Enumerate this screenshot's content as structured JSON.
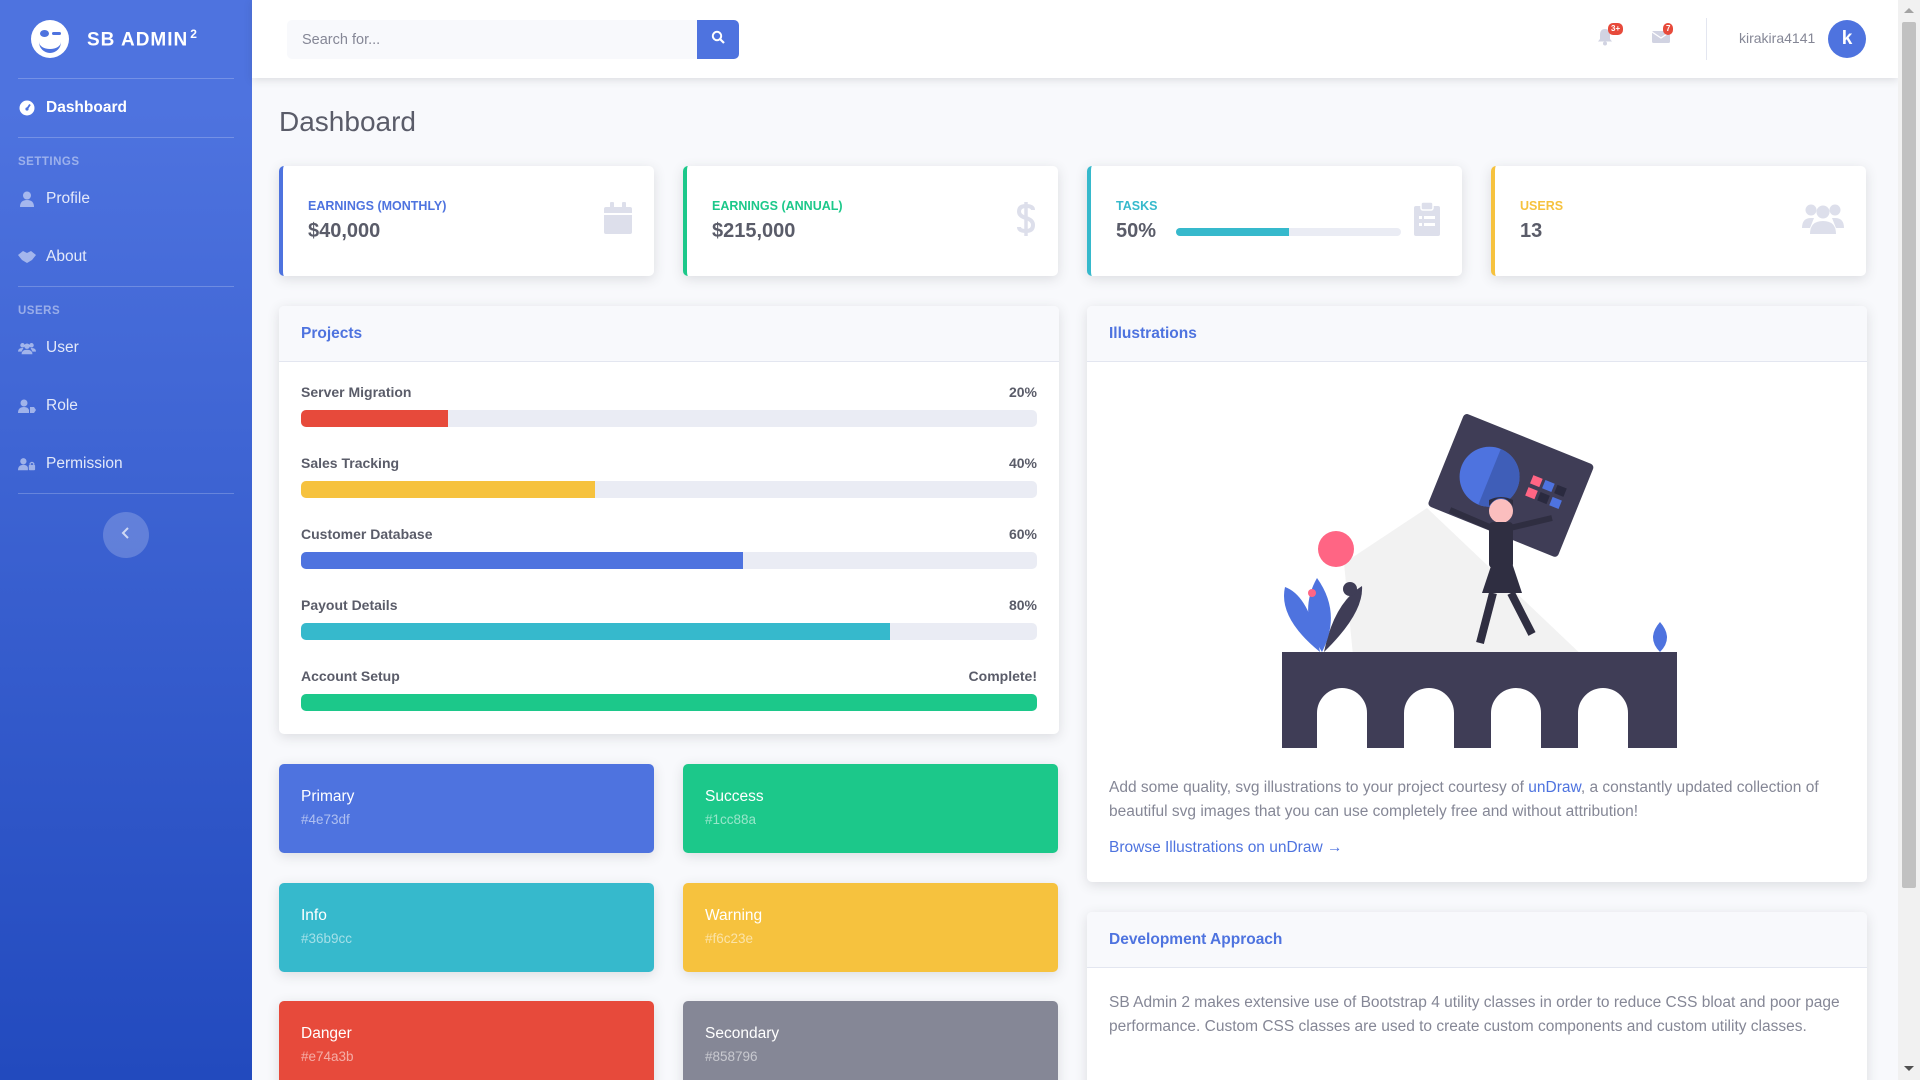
{
  "brand": {
    "name": "SB ADMIN",
    "sup": "2"
  },
  "sidebar": {
    "dashboard": "Dashboard",
    "settings_heading": "SETTINGS",
    "profile": "Profile",
    "about": "About",
    "users_heading": "USERS",
    "user": "User",
    "role": "Role",
    "permission": "Permission"
  },
  "topbar": {
    "search_placeholder": "Search for...",
    "alerts_badge": "3+",
    "messages_badge": "7",
    "username": "kirakira4141",
    "avatar_letter": "k"
  },
  "page_title": "Dashboard",
  "stats": [
    {
      "label": "EARNINGS (MONTHLY)",
      "value": "$40,000",
      "color": "#4e73df",
      "icon": "calendar-icon"
    },
    {
      "label": "EARNINGS (ANNUAL)",
      "value": "$215,000",
      "color": "#1cc88a",
      "icon": "dollar-icon"
    },
    {
      "label": "TASKS",
      "value": "50%",
      "progress": 50,
      "color": "#36b9cc",
      "icon": "clipboard-icon"
    },
    {
      "label": "USERS",
      "value": "13",
      "color": "#f6c23e",
      "icon": "users-icon"
    }
  ],
  "projects": {
    "title": "Projects",
    "items": [
      {
        "name": "Server Migration",
        "pct_label": "20%",
        "progress": 20,
        "color": "#e74a3b"
      },
      {
        "name": "Sales Tracking",
        "pct_label": "40%",
        "progress": 40,
        "color": "#f6c23e"
      },
      {
        "name": "Customer Database",
        "pct_label": "60%",
        "progress": 60,
        "color": "#4e73df"
      },
      {
        "name": "Payout Details",
        "pct_label": "80%",
        "progress": 80,
        "color": "#36b9cc"
      },
      {
        "name": "Account Setup",
        "pct_label": "Complete!",
        "progress": 100,
        "color": "#1cc88a"
      }
    ]
  },
  "colors": [
    {
      "name": "Primary",
      "hex": "#4e73df"
    },
    {
      "name": "Success",
      "hex": "#1cc88a"
    },
    {
      "name": "Info",
      "hex": "#36b9cc"
    },
    {
      "name": "Warning",
      "hex": "#f6c23e"
    },
    {
      "name": "Danger",
      "hex": "#e74a3b"
    },
    {
      "name": "Secondary",
      "hex": "#858796"
    }
  ],
  "illustrations": {
    "title": "Illustrations",
    "text_before": "Add some quality, svg illustrations to your project courtesy of ",
    "link_text": "unDraw",
    "text_after": ", a constantly updated collection of beautiful svg images that you can use completely free and without attribution!",
    "browse_link": "Browse Illustrations on unDraw →"
  },
  "development": {
    "title": "Development Approach",
    "text": "SB Admin 2 makes extensive use of Bootstrap 4 utility classes in order to reduce CSS bloat and poor page performance. Custom CSS classes are used to create custom components and custom utility classes."
  }
}
